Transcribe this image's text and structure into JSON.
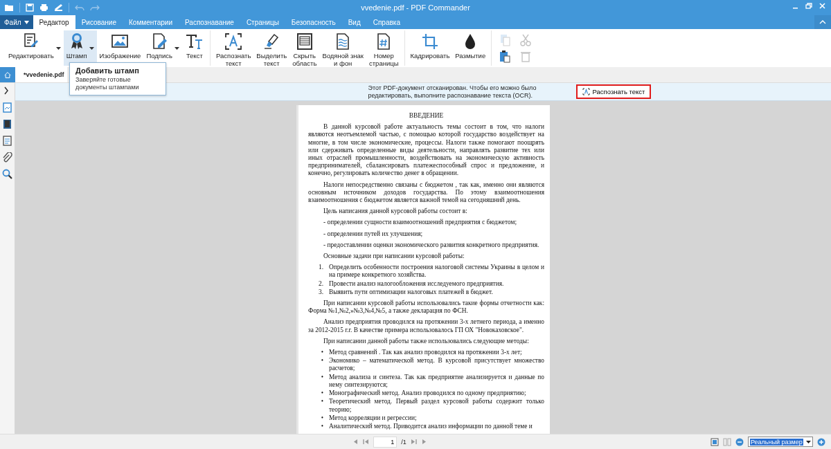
{
  "window": {
    "title": "vvedenie.pdf - PDF Commander"
  },
  "menu": {
    "file_button": "Файл",
    "tabs": [
      {
        "label": "Редактор",
        "selected": true
      },
      {
        "label": "Рисование",
        "selected": false
      },
      {
        "label": "Комментарии",
        "selected": false
      },
      {
        "label": "Распознавание",
        "selected": false
      },
      {
        "label": "Страницы",
        "selected": false
      },
      {
        "label": "Безопасность",
        "selected": false
      },
      {
        "label": "Вид",
        "selected": false
      },
      {
        "label": "Справка",
        "selected": false
      }
    ]
  },
  "ribbon": {
    "groups": [
      {
        "tools": [
          {
            "label": "Редактировать",
            "has_menu": true,
            "selected": false
          },
          {
            "label": "Штамп",
            "has_menu": true,
            "selected": true
          },
          {
            "label": "Изображение",
            "has_menu": false,
            "selected": false
          },
          {
            "label": "Подпись",
            "has_menu": true,
            "selected": false
          },
          {
            "label": "Текст",
            "has_menu": false,
            "selected": false
          }
        ]
      },
      {
        "tools": [
          {
            "label": "Распознать\nтекст",
            "has_menu": false,
            "selected": false
          },
          {
            "label": "Выделить\nтекст",
            "has_menu": false,
            "selected": false
          },
          {
            "label": "Скрыть\nобласть",
            "has_menu": false,
            "selected": false
          },
          {
            "label": "Водяной знак\nи фон",
            "has_menu": false,
            "selected": false
          },
          {
            "label": "Номер\nстраницы",
            "has_menu": false,
            "selected": false
          }
        ]
      },
      {
        "tools": [
          {
            "label": "Кадрировать",
            "has_menu": false,
            "selected": false
          },
          {
            "label": "Размытие",
            "has_menu": false,
            "selected": false
          }
        ]
      }
    ],
    "edit_tools": [
      {
        "disabled": true
      },
      {
        "disabled": true
      },
      {
        "disabled": false
      },
      {
        "disabled": true
      }
    ]
  },
  "tooltip": {
    "title": "Добавить штамп",
    "text": "Заверяйте готовые документы штампами"
  },
  "doc_tabs": [
    {
      "label": "*vvedenie.pdf",
      "selected": true
    }
  ],
  "notice": {
    "text": "Этот PDF-документ отсканирован. Чтобы его можно было редактировать, выполните распознавание текста (OCR).",
    "button": "Распознать текст"
  },
  "document": {
    "heading": "ВВЕДЕНИЕ",
    "blocks": [
      {
        "kind": "para",
        "text": "В данной курсовой работе актуальность темы состоит в том, что налоги являются неотъемлемой частью, с помощью которой государство воздействует на многие, в том числе экономические, процессы. Налоги также помогают поощрять или сдерживать определенные виды деятельности, направлять развитие тех или иных отраслей промышленности, воздействовать на экономическую активность предпринимателей, сбалансировать платежеспособный спрос и предложение, и конечно, регулировать количество денег в обращении."
      },
      {
        "kind": "para",
        "text": "Налоги непосредственно связаны с бюджетом , так как, именно они являются основным источником доходов государства. По этому взаимоотношения взаимоотношения с бюджетом является важной темой на сегодняшний день."
      },
      {
        "kind": "para",
        "text": "Цель написания данной курсовой работы состоит в:"
      },
      {
        "kind": "para",
        "text": "- определении сущности взаимоотношений предприятия с бюджетом;"
      },
      {
        "kind": "para",
        "text": "- определении путей их улучшения;"
      },
      {
        "kind": "para",
        "text": "- предоставлении оценки экономического развития конкретного предприятия."
      },
      {
        "kind": "para",
        "text": "Основные задачи при написании курсовой работы:"
      },
      {
        "kind": "list",
        "items": [
          {
            "marker": "1.",
            "text": "Определить особенности построения налоговой системы Украины в целом и на примере конкретного хозяйства."
          },
          {
            "marker": "2.",
            "text": "Провести анализ налогообложения исследуемого предприятия."
          },
          {
            "marker": "3.",
            "text": "Выявить пути оптимизации налоговых платежей в бюджет."
          }
        ]
      },
      {
        "kind": "para",
        "text": "При написании курсовой работы использовались такие формы отчетности как: Форма №1,№2,»№3,№4,№5, а также декларация по ФСН."
      },
      {
        "kind": "para",
        "text": "Анализ предприятия проводился на протяжении 3-х летнего периода, а именно за 2012-2015 г.г. В качестве примера использовалось ГП ОХ \"Новокаховское\"."
      },
      {
        "kind": "para",
        "text": "При написании данной работы также использовались следующие методы:"
      },
      {
        "kind": "list",
        "items": [
          {
            "marker": "•",
            "text": "Метод сравнений . Так как анализ проводился на протяжении 3-х лет;"
          },
          {
            "marker": "•",
            "text": "Экономико – математической метод. В курсовой присутствует множество расчетов;"
          },
          {
            "marker": "•",
            "text": "Метод анализа и синтеза. Так как предприятие анализируется и данные по нему синтезируются;"
          },
          {
            "marker": "•",
            "text": "Монографический метод. Анализ проводился по одному предприятию;"
          },
          {
            "marker": "•",
            "text": "Теоретический метод. Первый раздел курсовой работы содержит только теорию;"
          },
          {
            "marker": "•",
            "text": "Метод корреляции и регрессии;"
          },
          {
            "marker": "•",
            "text": "Аналитический метод. Приводится анализ информации по данной теме и"
          }
        ]
      }
    ]
  },
  "footer": {
    "page": "1",
    "total": "/1",
    "zoom": "Реальный размер"
  }
}
